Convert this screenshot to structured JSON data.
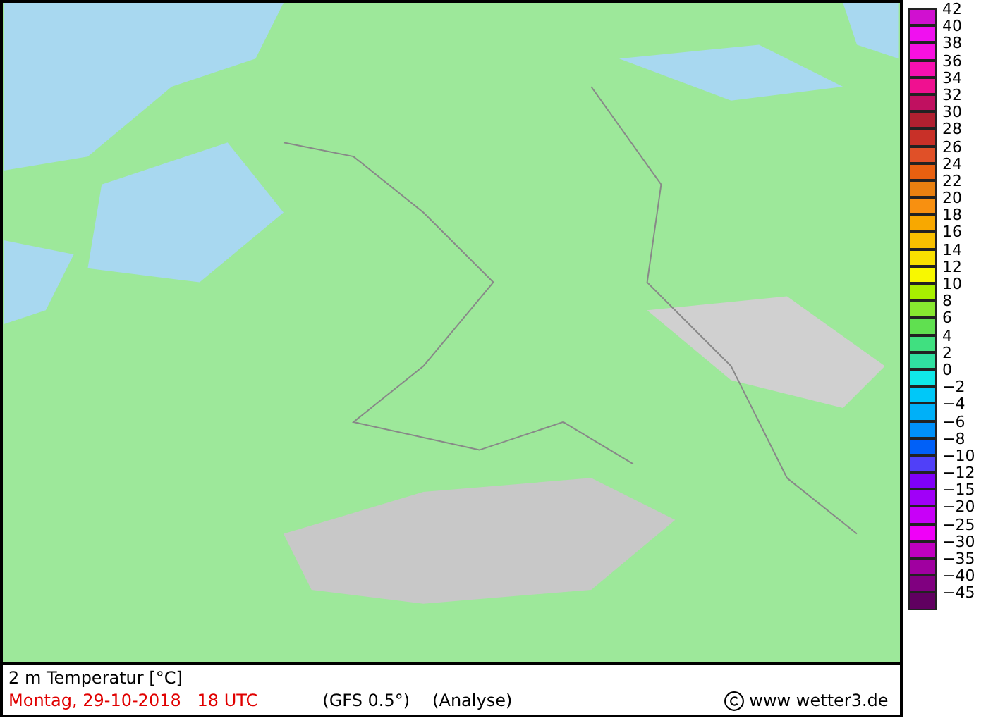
{
  "map": {
    "title": "2 m Temperatur [°C]",
    "date": "Montag, 29-10-2018   18 UTC",
    "model": "(GFS 0.5°)",
    "run": "(Analyse)",
    "credit": "www wetter3.de"
  },
  "legend": [
    {
      "label": "42",
      "color": "#d010d0"
    },
    {
      "label": "40",
      "color": "#f010f0"
    },
    {
      "label": "38",
      "color": "#f810e0"
    },
    {
      "label": "36",
      "color": "#f810b0"
    },
    {
      "label": "34",
      "color": "#f01090"
    },
    {
      "label": "32",
      "color": "#c01060"
    },
    {
      "label": "30",
      "color": "#b02030"
    },
    {
      "label": "28",
      "color": "#c83028"
    },
    {
      "label": "26",
      "color": "#e05028"
    },
    {
      "label": "24",
      "color": "#e86010"
    },
    {
      "label": "22",
      "color": "#e88010"
    },
    {
      "label": "20",
      "color": "#f89010"
    },
    {
      "label": "18",
      "color": "#f8a800"
    },
    {
      "label": "16",
      "color": "#f8c000"
    },
    {
      "label": "14",
      "color": "#f8e000"
    },
    {
      "label": "12",
      "color": "#f8f800"
    },
    {
      "label": "10",
      "color": "#a8f000"
    },
    {
      "label": "8",
      "color": "#88e830"
    },
    {
      "label": "6",
      "color": "#60e050"
    },
    {
      "label": "4",
      "color": "#40e080"
    },
    {
      "label": "2",
      "color": "#30e0a0"
    },
    {
      "label": "0",
      "color": "#10e8e8"
    },
    {
      "label": "−2",
      "color": "#00c8f8"
    },
    {
      "label": "−4",
      "color": "#00b0f8"
    },
    {
      "label": "−6",
      "color": "#0090f8"
    },
    {
      "label": "−8",
      "color": "#0060f8"
    },
    {
      "label": "−10",
      "color": "#5040f8"
    },
    {
      "label": "−12",
      "color": "#8000f8"
    },
    {
      "label": "−15",
      "color": "#a000f8"
    },
    {
      "label": "−20",
      "color": "#c800f8"
    },
    {
      "label": "−25",
      "color": "#f000f8"
    },
    {
      "label": "−30",
      "color": "#c000c0"
    },
    {
      "label": "−35",
      "color": "#a000a0"
    },
    {
      "label": "−40",
      "color": "#800080"
    },
    {
      "label": "−45",
      "color": "#600060"
    }
  ]
}
